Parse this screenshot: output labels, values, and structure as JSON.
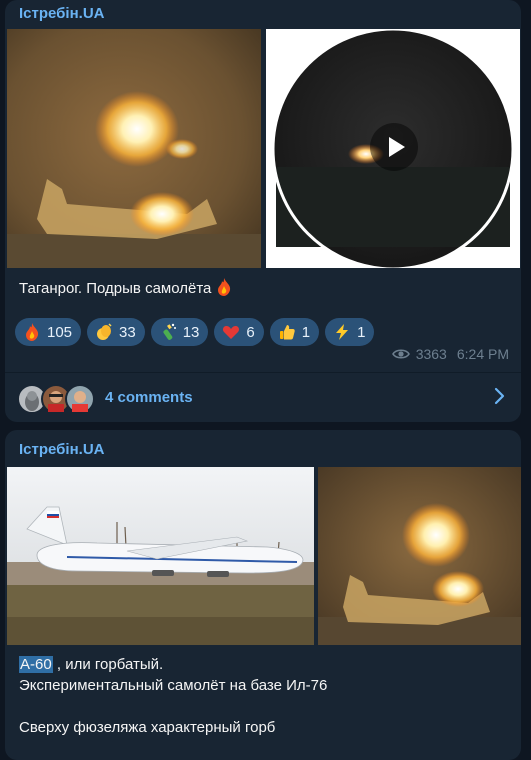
{
  "posts": [
    {
      "channel": "Істребін.UA",
      "caption": "Таганрог. Подрыв самолёта",
      "reactions": [
        {
          "emoji": "fire",
          "count": "105"
        },
        {
          "emoji": "clap",
          "count": "33"
        },
        {
          "emoji": "champagne",
          "count": "13"
        },
        {
          "emoji": "heart",
          "count": "6"
        },
        {
          "emoji": "thumbs-up",
          "count": "1"
        },
        {
          "emoji": "lightning",
          "count": "1"
        }
      ],
      "views": "3363",
      "time": "6:24 PM",
      "comments_label": "4 comments"
    },
    {
      "channel": "Істребін.UA",
      "highlight": "А-60",
      "line1_rest": " , или горбатый.",
      "line2": "Экспериментальный самолёт на базе Ил-76",
      "line3": "Сверху фюзеляжа характерный горб"
    }
  ],
  "colors": {
    "background": "#0e1621",
    "bubble": "#182533",
    "accent": "#6ab3f3",
    "reaction_bg": "#2b5278",
    "meta": "#6d7f8f"
  }
}
